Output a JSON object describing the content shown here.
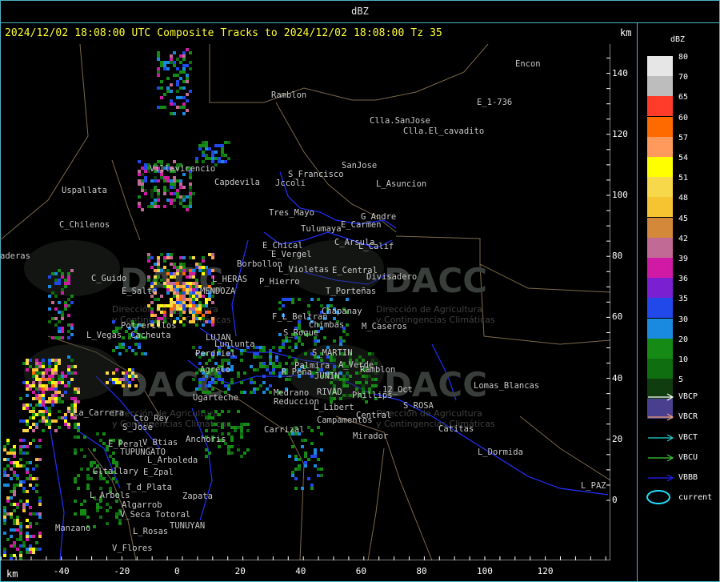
{
  "window": {
    "title": "dBZ"
  },
  "header": {
    "text": "2024/12/02 18:08:00 UTC Composite Tracks to 2024/12/02 18:08:00 Tz 35",
    "km_top": "km",
    "km_bottom": "km"
  },
  "axes": {
    "y_ticks": [
      "140",
      "120",
      "100",
      "80",
      "60",
      "40",
      "20",
      "0"
    ],
    "x_ticks": [
      "-40",
      "-20",
      "0",
      "20",
      "40",
      "60",
      "80",
      "100",
      "120"
    ]
  },
  "legend": {
    "title": "dBZ",
    "scale": [
      {
        "label": "80",
        "color": "#e6e6e6"
      },
      {
        "label": "70",
        "color": "#bdbdbd"
      },
      {
        "label": "65",
        "color": "#ff3b2a"
      },
      {
        "label": "60",
        "color": "#ff6a00"
      },
      {
        "label": "57",
        "color": "#ff9a5c"
      },
      {
        "label": "54",
        "color": "#ffff00"
      },
      {
        "label": "51",
        "color": "#f7d84a"
      },
      {
        "label": "48",
        "color": "#f7c431"
      },
      {
        "label": "45",
        "color": "#d4883a"
      },
      {
        "label": "42",
        "color": "#c26a96"
      },
      {
        "label": "39",
        "color": "#d01aa6"
      },
      {
        "label": "36",
        "color": "#7a20d0"
      },
      {
        "label": "35",
        "color": "#2148e8"
      },
      {
        "label": "30",
        "color": "#1a8ae0"
      },
      {
        "label": "20",
        "color": "#158a15"
      },
      {
        "label": "10",
        "color": "#0f6e0f"
      },
      {
        "label": "5",
        "color": "#103d10"
      },
      {
        "label": "",
        "color": "#4a3f8f"
      }
    ],
    "tracks": [
      {
        "label": "VBCP",
        "color": "#ffffff"
      },
      {
        "label": "VBCR",
        "color": "#f0a070"
      },
      {
        "label": "VBCT",
        "color": "#21d4d4"
      },
      {
        "label": "VBCU",
        "color": "#3acb3a"
      },
      {
        "label": "VBBB",
        "color": "#2020ff"
      }
    ],
    "current_label": "current",
    "current_color": "#1fe0ff"
  },
  "places": [
    {
      "name": "Ramblon"
    },
    {
      "name": "Encon"
    },
    {
      "name": "E_1-736"
    },
    {
      "name": "Clla.SanJose"
    },
    {
      "name": "Clla.El_cavadito"
    },
    {
      "name": "SanJose"
    },
    {
      "name": "S_Francisco"
    },
    {
      "name": "Jccoli"
    },
    {
      "name": "L_Asuncion"
    },
    {
      "name": "Capdevila"
    },
    {
      "name": "Villavicencio"
    },
    {
      "name": "Uspallata"
    },
    {
      "name": "Tres_Mayo"
    },
    {
      "name": "G_Andre"
    },
    {
      "name": "Tulumaya"
    },
    {
      "name": "E_Carmen"
    },
    {
      "name": "C_Arsula"
    },
    {
      "name": "L_Calif"
    },
    {
      "name": "C_Chilenos"
    },
    {
      "name": "E_Chical"
    },
    {
      "name": "E_Vergel"
    },
    {
      "name": "Borbollon"
    },
    {
      "name": "P_Hierro"
    },
    {
      "name": "L_Violetas"
    },
    {
      "name": "E_Central"
    },
    {
      "name": "Divisadero"
    },
    {
      "name": "C_Guido"
    },
    {
      "name": "L_HERAS"
    },
    {
      "name": "T_Porteñas"
    },
    {
      "name": "Chapanay"
    },
    {
      "name": "F_L_Beltran"
    },
    {
      "name": "Chimbas"
    },
    {
      "name": "M_Caseros"
    },
    {
      "name": "Potrerillos"
    },
    {
      "name": "L_Vegas"
    },
    {
      "name": "Cacheuta"
    },
    {
      "name": "LUJAN"
    },
    {
      "name": "Lunlunta"
    },
    {
      "name": "S_Roque"
    },
    {
      "name": "S_MARTIN"
    },
    {
      "name": "Perdriel"
    },
    {
      "name": "Palmira"
    },
    {
      "name": "A_Verde"
    },
    {
      "name": "Ramblon"
    },
    {
      "name": "Agrelo"
    },
    {
      "name": "R_Peña"
    },
    {
      "name": "JUNIN"
    },
    {
      "name": "Lomas_Blancas"
    },
    {
      "name": "RIVAD"
    },
    {
      "name": "Phillips"
    },
    {
      "name": "12_Oct"
    },
    {
      "name": "Medrano"
    },
    {
      "name": "Reduccion"
    },
    {
      "name": "Ugarteche"
    },
    {
      "name": "L_Libert"
    },
    {
      "name": "S_ROSA"
    },
    {
      "name": "La_Carrera"
    },
    {
      "name": "Cto_Rey"
    },
    {
      "name": "Campamentos"
    },
    {
      "name": "Central"
    },
    {
      "name": "S_Jose"
    },
    {
      "name": "Carrizal"
    },
    {
      "name": "Catitas"
    },
    {
      "name": "E_Peral"
    },
    {
      "name": "V_Btias"
    },
    {
      "name": "Anchoris"
    },
    {
      "name": "Mirador"
    },
    {
      "name": "TUPUNGATO"
    },
    {
      "name": "L_Dormida"
    },
    {
      "name": "L_Arboleda"
    },
    {
      "name": "Gltallary"
    },
    {
      "name": "E_Zpal"
    },
    {
      "name": "T_d_Plata"
    },
    {
      "name": "L_PAZ"
    },
    {
      "name": "L_Arbols"
    },
    {
      "name": "Zapata"
    },
    {
      "name": "Algarrob"
    },
    {
      "name": "V_Seca"
    },
    {
      "name": "Totoral"
    },
    {
      "name": "Manzano"
    },
    {
      "name": "L_Rosas"
    },
    {
      "name": "TUNUYAN"
    },
    {
      "name": "V_Flores"
    },
    {
      "name": "aderas"
    },
    {
      "name": "E_Salto"
    },
    {
      "name": "MENDOZA"
    }
  ],
  "watermarks": [
    {
      "text": "DACC"
    },
    {
      "text": "Dirección de Agricultura"
    },
    {
      "text": "y Contingencias Climáticas"
    }
  ]
}
